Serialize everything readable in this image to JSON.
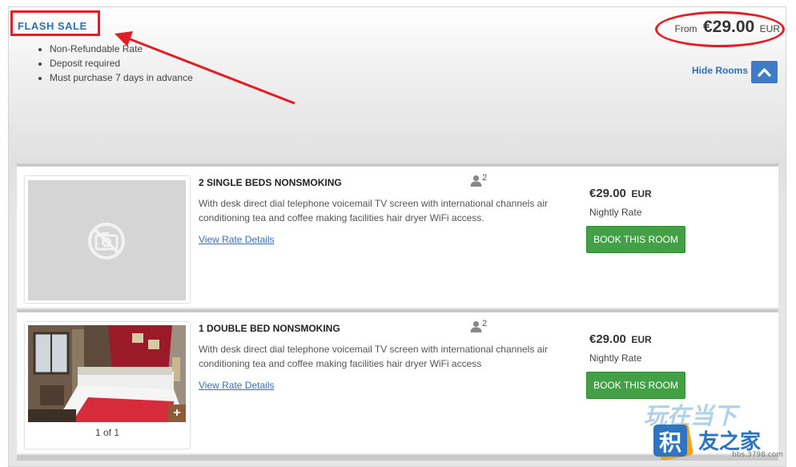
{
  "rate": {
    "title": "FLASH SALE",
    "conditions": [
      "Non-Refundable Rate",
      "Deposit required",
      "Must purchase 7 days in advance"
    ],
    "from_label": "From",
    "from_price": "€29.00",
    "from_currency": "EUR",
    "hide_rooms_label": "Hide Rooms"
  },
  "rooms": [
    {
      "title": "2 SINGLE BEDS NONSMOKING",
      "occupancy": "2",
      "description": "With desk direct dial telephone voicemail TV screen with international channels air conditioning tea and coffee making facilities hair dryer WiFi access.",
      "rate_link": "View Rate Details",
      "price": "€29.00",
      "currency": "EUR",
      "rate_type": "Nightly Rate",
      "book_label": "BOOK THIS ROOM",
      "image": "no-image-placeholder"
    },
    {
      "title": "1 DOUBLE BED NONSMOKING",
      "occupancy": "2",
      "description": "With desk direct dial telephone voicemail TV screen with international channels air conditioning tea and coffee making facilities hair dryer WiFi access",
      "rate_link": "View Rate Details",
      "price": "€29.00",
      "currency": "EUR",
      "rate_type": "Nightly Rate",
      "book_label": "BOOK THIS ROOM",
      "image": "hotel-room-photo",
      "image_counter": "1 of 1"
    }
  ],
  "watermark": {
    "line1": "玩在当下",
    "line2": "积",
    "line3": "友之家",
    "url": "bbs.3798.com"
  },
  "colors": {
    "accent_blue": "#2f6fb6",
    "button_green": "#43a047",
    "annotation_red": "#e41c23"
  },
  "icons": [
    "chevron-up-icon",
    "person-icon",
    "no-image-icon",
    "plus-icon",
    "annotation-arrow"
  ]
}
